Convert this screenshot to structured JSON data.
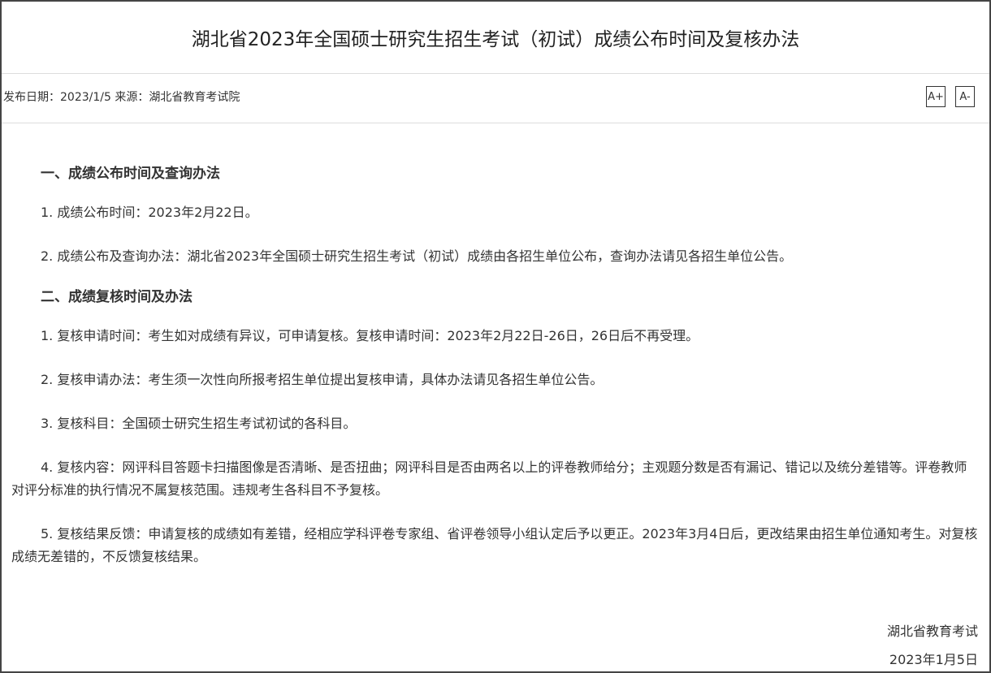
{
  "article": {
    "title": "湖北省2023年全国硕士研究生招生考试（初试）成绩公布时间及复核办法",
    "meta": "发布日期：2023/1/5 来源：湖北省教育考试院",
    "font_increase_label": "A+",
    "font_decrease_label": "A-"
  },
  "sections": [
    {
      "heading": "一、成绩公布时间及查询办法",
      "paragraphs": [
        "1. 成绩公布时间：2023年2月22日。",
        "2. 成绩公布及查询办法：湖北省2023年全国硕士研究生招生考试（初试）成绩由各招生单位公布，查询办法请见各招生单位公告。"
      ]
    },
    {
      "heading": "二、成绩复核时间及办法",
      "paragraphs": [
        "1. 复核申请时间：考生如对成绩有异议，可申请复核。复核申请时间：2023年2月22日-26日，26日后不再受理。",
        "2. 复核申请办法：考生须一次性向所报考招生单位提出复核申请，具体办法请见各招生单位公告。",
        "3. 复核科目：全国硕士研究生招生考试初试的各科目。",
        "4. 复核内容：网评科目答题卡扫描图像是否清晰、是否扭曲；网评科目是否由两名以上的评卷教师给分；主观题分数是否有漏记、错记以及统分差错等。评卷教师对评分标准的执行情况不属复核范围。违规考生各科目不予复核。",
        "5. 复核结果反馈：申请复核的成绩如有差错，经相应学科评卷专家组、省评卷领导小组认定后予以更正。2023年3月4日后，更改结果由招生单位通知考生。对复核成绩无差错的，不反馈复核结果。"
      ]
    }
  ],
  "signature": {
    "org": "湖北省教育考试",
    "date": "2023年1月5日"
  }
}
